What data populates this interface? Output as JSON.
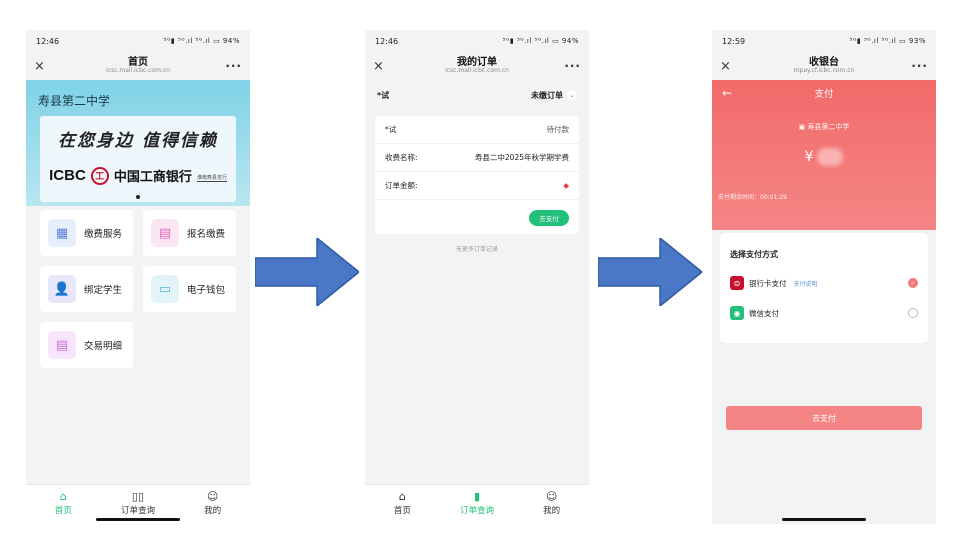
{
  "colors": {
    "accent_green": "#22c07a",
    "pay_red": "#f26a6a",
    "arrow_blue": "#4a78c6",
    "icbc_red": "#c8102e"
  },
  "phone1": {
    "status": {
      "time": "12:46",
      "icons": "⁵ᴳ▮ ⁵ᴳ.ıl ⁵ᴳ.ıl ▭ 94%"
    },
    "nav": {
      "close": "×",
      "title": "首页",
      "url": "icsc.mall.icbc.com.cn",
      "more": "···"
    },
    "school": "寿县第二中学",
    "banner": {
      "slogan": "在您身边 值得信赖",
      "icbc": "ICBC",
      "logo_glyph": "工",
      "cn_name": "中国工商银行",
      "branch": "淮南寿县支行"
    },
    "cards": [
      {
        "label": "缴费服务",
        "icon": "grid-icon",
        "glyph": "▦",
        "bg": "#e6eefc",
        "fg": "#5b7fd6"
      },
      {
        "label": "报名缴费",
        "icon": "form-icon",
        "glyph": "▤",
        "bg": "#fbe6f4",
        "fg": "#e06bc4"
      },
      {
        "label": "绑定学生",
        "icon": "user-icon",
        "glyph": "👤",
        "bg": "#e8e6fb",
        "fg": "#6e61d6"
      },
      {
        "label": "电子钱包",
        "icon": "wallet-icon",
        "glyph": "▭",
        "bg": "#e3f4f9",
        "fg": "#5bb7d6"
      },
      {
        "label": "交易明细",
        "icon": "list-icon",
        "glyph": "▤",
        "bg": "#f7e6fb",
        "fg": "#c86be0"
      }
    ],
    "tabs": [
      {
        "label": "首页",
        "glyph": "⌂",
        "icon": "home-icon",
        "active": true
      },
      {
        "label": "订单查询",
        "glyph": "▯▯",
        "icon": "orders-icon",
        "active": false
      },
      {
        "label": "我的",
        "glyph": "☺",
        "icon": "profile-icon",
        "active": false
      }
    ]
  },
  "phone2": {
    "status": {
      "time": "12:46",
      "icons": "⁵ᴳ▮ ⁵ᴳ.ıl ⁵ᴳ.ıl ▭ 94%"
    },
    "nav": {
      "close": "×",
      "title": "我的订单",
      "url": "icsc.mall.icbc.com.cn",
      "more": "···"
    },
    "filter": {
      "left": "*试",
      "right": "未缴订单",
      "chevron": "⌄"
    },
    "order": {
      "name": "*试",
      "status": "待付款",
      "item_label": "收费名称:",
      "item_value": "寿县二中2025年秋学期学费",
      "amount_label": "订单金额:",
      "pay_button": "去支付"
    },
    "no_more": "无更多订单记录",
    "tabs": [
      {
        "label": "首页",
        "glyph": "⌂",
        "icon": "home-icon",
        "active": false
      },
      {
        "label": "订单查询",
        "glyph": "▮",
        "icon": "orders-icon",
        "active": true
      },
      {
        "label": "我的",
        "glyph": "☺",
        "icon": "profile-icon",
        "active": false
      }
    ]
  },
  "phone3": {
    "status": {
      "time": "12:59",
      "icons": "⁵ᴳ▮ ⁵ᴳ.ıl ⁵ᴳ.ıl ▭ 93%"
    },
    "nav": {
      "close": "×",
      "title": "收银台",
      "url": "mpay.cf.icbc.com.cn",
      "more": "···"
    },
    "header": {
      "back": "←",
      "title": "支付",
      "merchant": "寿县第二中学",
      "currency": "¥",
      "countdown": "支付剩余时间：00:01:29"
    },
    "methods_title": "选择支付方式",
    "methods": [
      {
        "label": "银行卡支付",
        "sub": "支付说明",
        "icon": "bank-card-icon",
        "glyph": "⊜",
        "kind": "bank",
        "checked": true
      },
      {
        "label": "微信支付",
        "sub": "",
        "icon": "wechat-icon",
        "glyph": "◉",
        "kind": "wechat",
        "checked": false
      }
    ],
    "go_pay": "去支付"
  }
}
